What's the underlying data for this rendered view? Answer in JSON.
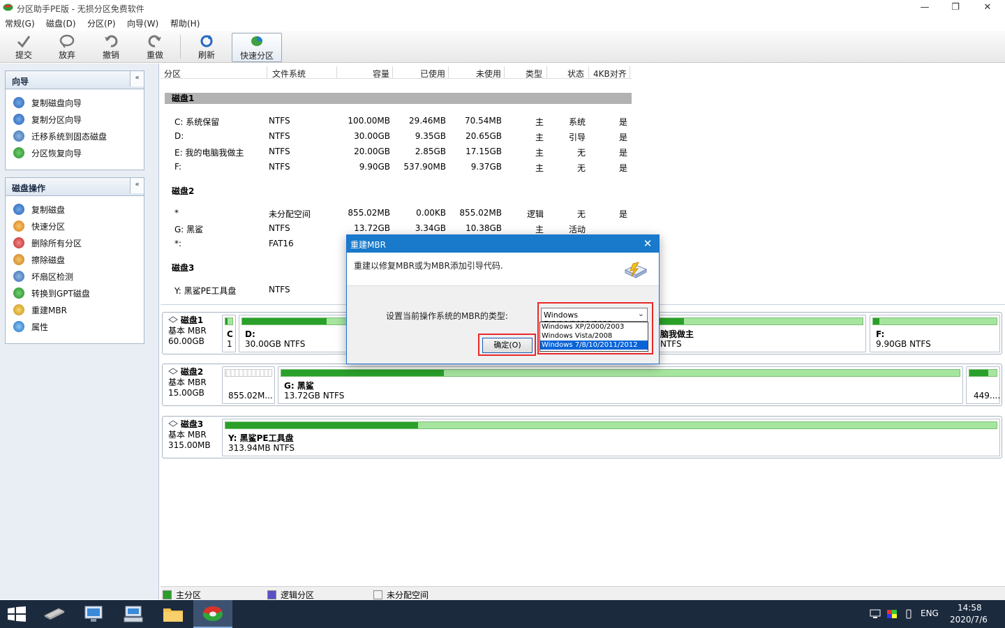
{
  "window": {
    "title": "分区助手PE版 - 无损分区免费软件",
    "controls": {
      "minimize": "—",
      "restore": "❐",
      "close": "✕"
    }
  },
  "menu": [
    "常规(G)",
    "磁盘(D)",
    "分区(P)",
    "向导(W)",
    "帮助(H)"
  ],
  "toolbar": {
    "commit": "提交",
    "discard": "放弃",
    "undo": "撤销",
    "redo": "重做",
    "refresh": "刷新",
    "quick_partition": "快速分区"
  },
  "wizard_panel": {
    "title": "向导",
    "collapse": "«",
    "items": [
      "复制磁盘向导",
      "复制分区向导",
      "迁移系统到固态磁盘",
      "分区恢复向导"
    ]
  },
  "disk_ops_panel": {
    "title": "磁盘操作",
    "collapse": "«",
    "items": [
      "复制磁盘",
      "快速分区",
      "删除所有分区",
      "擦除磁盘",
      "坏扇区检测",
      "转换到GPT磁盘",
      "重建MBR",
      "属性"
    ]
  },
  "table": {
    "columns": [
      "分区",
      "文件系统",
      "容量",
      "已使用",
      "未使用",
      "类型",
      "状态",
      "4KB对齐"
    ],
    "disks": [
      {
        "name": "磁盘1",
        "rows": [
          [
            "C: 系统保留",
            "NTFS",
            "100.00MB",
            "29.46MB",
            "70.54MB",
            "主",
            "系统",
            "是"
          ],
          [
            "D:",
            "NTFS",
            "30.00GB",
            "9.35GB",
            "20.65GB",
            "主",
            "引导",
            "是"
          ],
          [
            "E: 我的电脑我做主",
            "NTFS",
            "20.00GB",
            "2.85GB",
            "17.15GB",
            "主",
            "无",
            "是"
          ],
          [
            "F:",
            "NTFS",
            "9.90GB",
            "537.90MB",
            "9.37GB",
            "主",
            "无",
            "是"
          ]
        ]
      },
      {
        "name": "磁盘2",
        "rows": [
          [
            "*",
            "未分配空间",
            "855.02MB",
            "0.00KB",
            "855.02MB",
            "逻辑",
            "无",
            "是"
          ],
          [
            "G: 黑鲨",
            "NTFS",
            "13.72GB",
            "3.34GB",
            "10.38GB",
            "主",
            "活动",
            ""
          ],
          [
            "*:",
            "FAT16",
            "",
            "",
            "",
            "",
            "",
            ""
          ]
        ]
      },
      {
        "name": "磁盘3",
        "rows": [
          [
            "Y: 黑鲨PE工具盘",
            "NTFS",
            "",
            "",
            "",
            "",
            "",
            ""
          ]
        ]
      }
    ]
  },
  "disk_map": [
    {
      "name": "磁盘1",
      "type": "基本 MBR",
      "size": "60.00GB",
      "partitions": [
        {
          "label": "C",
          "detail": "1",
          "used_fraction": 0.29
        },
        {
          "label": "D:",
          "detail": "30.00GB NTFS",
          "used_fraction": 0.31
        },
        {
          "label": "脑我做主",
          "detail": "NTFS",
          "used_fraction": 0.14
        },
        {
          "label": "F:",
          "detail": "9.90GB NTFS",
          "used_fraction": 0.05
        }
      ]
    },
    {
      "name": "磁盘2",
      "type": "基本 MBR",
      "size": "15.00GB",
      "partitions": [
        {
          "label": "",
          "detail": "855.02M...",
          "used_fraction": 0
        },
        {
          "label": "G: 黑鲨",
          "detail": "13.72GB NTFS",
          "used_fraction": 0.24
        },
        {
          "label": "",
          "detail": "449....",
          "used_fraction": 0.7
        }
      ]
    },
    {
      "name": "磁盘3",
      "type": "基本 MBR",
      "size": "315.00MB",
      "partitions": [
        {
          "label": "Y: 黑鲨PE工具盘",
          "detail": "313.94MB NTFS",
          "used_fraction": 0.25
        }
      ]
    }
  ],
  "legend": {
    "primary": "主分区",
    "logical": "逻辑分区",
    "unallocated": "未分配空间"
  },
  "dialog": {
    "title": "重建MBR",
    "close": "✕",
    "description": "重建以修复MBR或为MBR添加引导代码.",
    "label": "设置当前操作系统的MBR的类型:",
    "selected": "Windows 7/8/10/2011/2012",
    "options": [
      "Windows XP/2000/2003",
      "Windows Vista/2008",
      "Windows 7/8/10/2011/2012"
    ],
    "ok_button": "确定(O)"
  },
  "tray": {
    "lang": "ENG",
    "time": "14:58",
    "date": "2020/7/6"
  },
  "colors": {
    "accent": "#1979ca",
    "bar_used": "#2aa02a",
    "bar_free": "#a6e5a0",
    "highlight": "#e8282a"
  }
}
